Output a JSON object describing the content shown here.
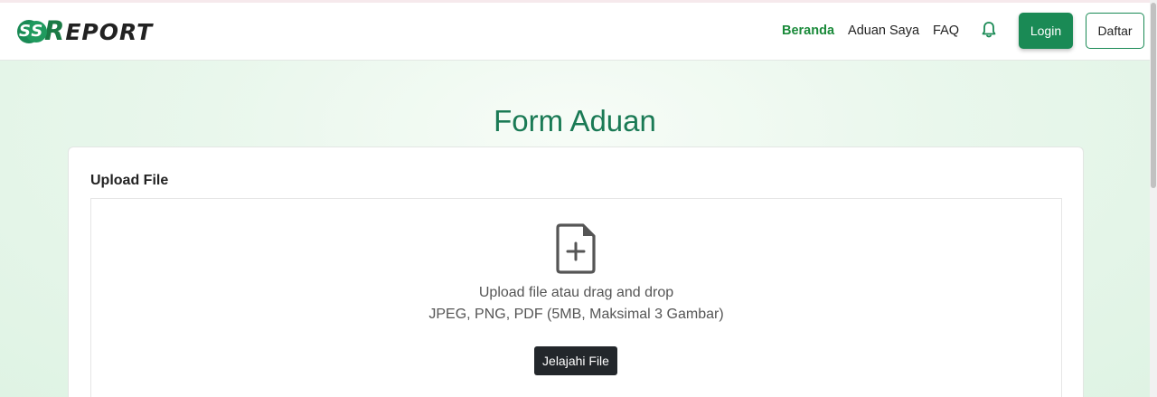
{
  "brand": {
    "logo_prefix": "SS",
    "logo_r": "R",
    "logo_rest": "EPORT",
    "accent": "#1a8a55"
  },
  "nav": {
    "links": [
      {
        "label": "Beranda",
        "active": true
      },
      {
        "label": "Aduan Saya",
        "active": false
      },
      {
        "label": "FAQ",
        "active": false
      }
    ],
    "notification_icon": "bell-icon",
    "login_label": "Login",
    "register_label": "Daftar"
  },
  "page": {
    "title": "Form Aduan"
  },
  "upload": {
    "label": "Upload File",
    "icon": "file-plus-icon",
    "instruction": "Upload file atau drag and drop",
    "formats": "JPEG, PNG, PDF (5MB, Maksimal 3 Gambar)",
    "browse_label": "Jelajahi File"
  }
}
